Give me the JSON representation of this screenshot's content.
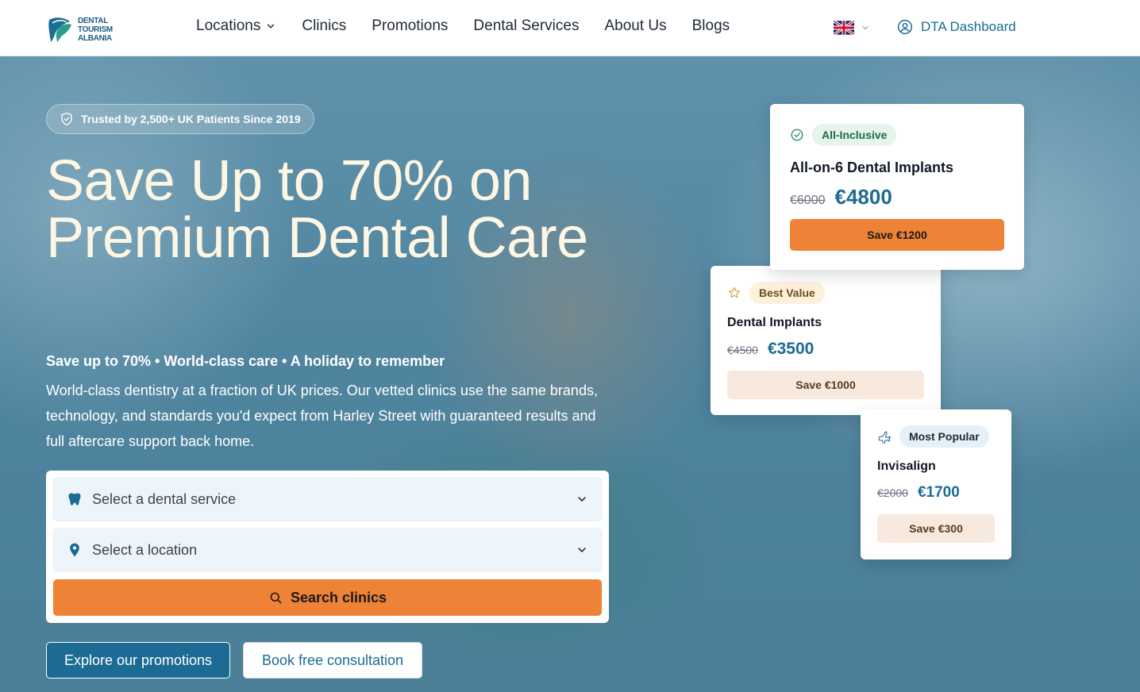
{
  "header": {
    "logo_lines": [
      "DENTAL",
      "TOURISM",
      "ALBANIA"
    ],
    "nav": [
      {
        "label": "Locations",
        "has_dropdown": true
      },
      {
        "label": "Clinics"
      },
      {
        "label": "Promotions"
      },
      {
        "label": "Dental Services"
      },
      {
        "label": "About Us"
      },
      {
        "label": "Blogs"
      }
    ],
    "language": "UK flag",
    "dashboard_label": "DTA Dashboard"
  },
  "hero": {
    "trust_badge": "Trusted by 2,500+ UK Patients Since 2019",
    "title": "Save Up to 70% on Premium Dental Care",
    "subtitle": "Save up to 70% • World-class care • A holiday to remember",
    "description": "World-class dentistry at a fraction of UK prices. Our vetted clinics use the same brands, technology, and standards you'd expect from Harley Street with guaranteed results and full aftercare support back home."
  },
  "search": {
    "service_placeholder": "Select a dental service",
    "location_placeholder": "Select a location",
    "button_label": "Search clinics"
  },
  "actions": {
    "promotions_label": "Explore our promotions",
    "consultation_label": "Book free consultation"
  },
  "promos": [
    {
      "tag": "All-Inclusive",
      "tag_icon": "check-circle-icon",
      "name": "All-on-6 Dental Implants",
      "old_price": "€6000",
      "new_price": "€4800",
      "save": "Save €1200"
    },
    {
      "tag": "Best Value",
      "tag_icon": "star-icon",
      "name": "Dental Implants",
      "old_price": "€4500",
      "new_price": "€3500",
      "save": "Save €1000"
    },
    {
      "tag": "Most Popular",
      "tag_icon": "plane-icon",
      "name": "Invisalign",
      "old_price": "€2000",
      "new_price": "€1700",
      "save": "Save €300"
    }
  ],
  "colors": {
    "brand_blue": "#1b6b94",
    "accent_orange": "#ee8236",
    "hero_title": "#fdf6e3"
  }
}
